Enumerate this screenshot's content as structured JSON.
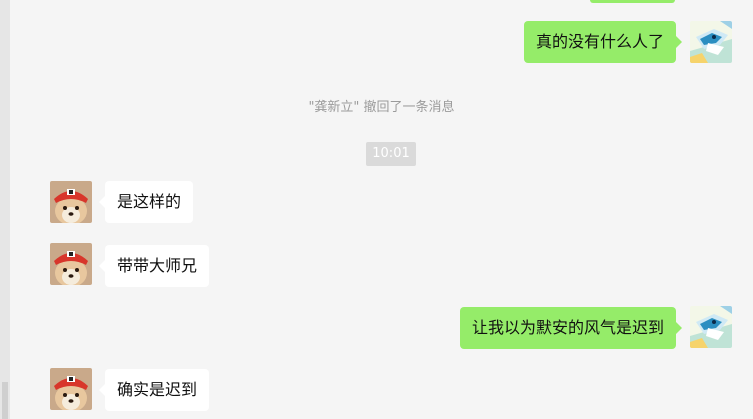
{
  "window": {
    "title": "龚新立"
  },
  "messages": [
    {
      "side": "sent",
      "text": "真的没有什么人了",
      "sender": "me"
    },
    {
      "side": "recv",
      "text": "是这样的",
      "sender": "龚新立"
    },
    {
      "side": "recv",
      "text": "带带大师兄",
      "sender": "龚新立"
    },
    {
      "side": "sent",
      "text": "让我以为默安的风气是迟到",
      "sender": "me"
    },
    {
      "side": "recv",
      "text": "确实是迟到",
      "sender": "龚新立"
    }
  ],
  "system_notice": "\"龚新立\" 撤回了一条消息",
  "timestamp": "10:01",
  "colors": {
    "sent_bubble": "#95ec69",
    "recv_bubble": "#ffffff",
    "background": "#f5f5f5",
    "timestamp_bg": "#dadada"
  },
  "icons": {
    "my_avatar": "anime-pokemon-avatar-icon",
    "peer_avatar": "shiba-dog-red-hat-avatar-icon"
  }
}
